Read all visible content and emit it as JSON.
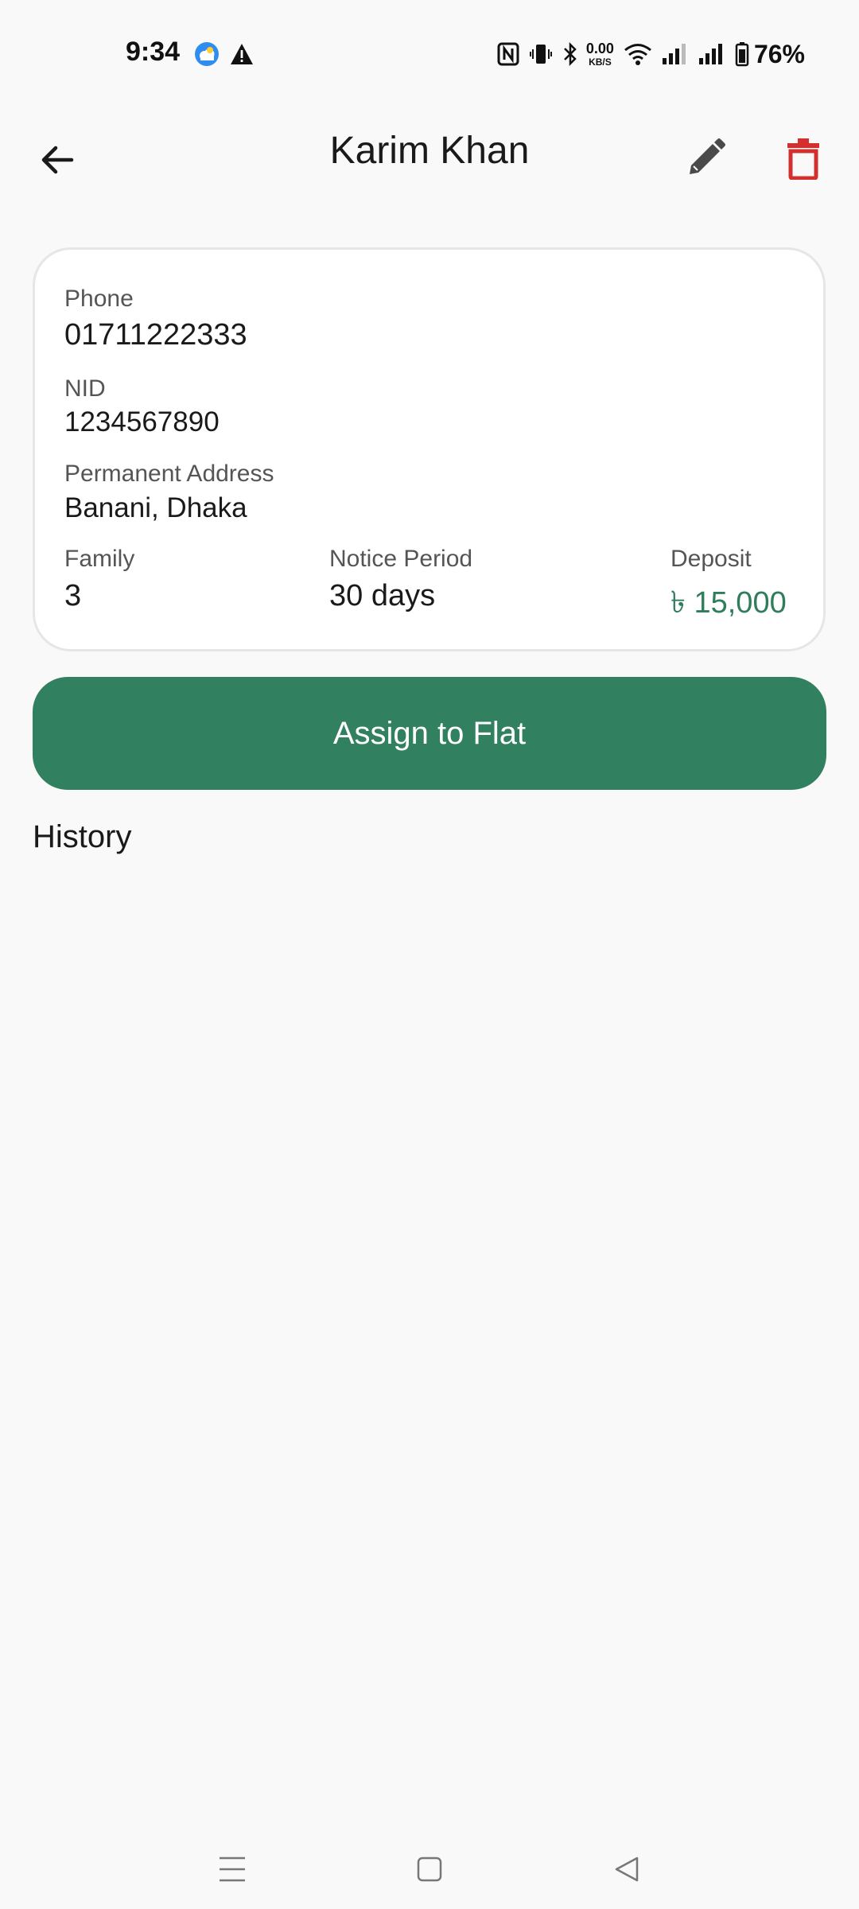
{
  "status_bar": {
    "time": "9:34",
    "net_speed_value": "0.00",
    "net_speed_unit": "KB/S",
    "battery_percent": "76%"
  },
  "app_bar": {
    "title": "Karim Khan",
    "icons": [
      "arrow-back-icon",
      "edit-icon",
      "delete-icon"
    ],
    "delete_color": "#d32f2f"
  },
  "tenant": {
    "phone_label": "Phone",
    "phone": "01711222333",
    "nid_label": "NID",
    "nid": "1234567890",
    "address_label": "Permanent Address",
    "address": "Banani, Dhaka",
    "family_label": "Family",
    "family": "3",
    "notice_label": "Notice Period",
    "notice": "30 days",
    "deposit_label": "Deposit",
    "deposit": "৳ 15,000"
  },
  "actions": {
    "assign_label": "Assign to Flat",
    "accent_color": "#318060"
  },
  "history": {
    "heading": "History"
  },
  "nav_bar": {
    "icons": [
      "menu-icon",
      "home-icon",
      "back-triangle-icon"
    ]
  }
}
